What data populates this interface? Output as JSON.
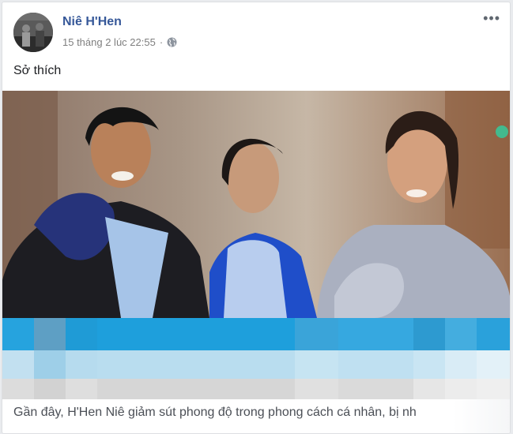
{
  "post": {
    "author": "Niê H'Hen",
    "timestamp": "15 tháng 2 lúc 22:55",
    "separator": "·",
    "privacy_icon": "globe-icon",
    "more_label": "•••",
    "text": "Sở thích"
  },
  "caption": {
    "text": "Gần đây, H'Hen Niê giảm sút phong độ trong phong cách cá nhân, bị nh"
  },
  "colors": {
    "author_link": "#365899",
    "accent_blue": "#1e9fdc",
    "light_blue": "#b9ddef"
  }
}
